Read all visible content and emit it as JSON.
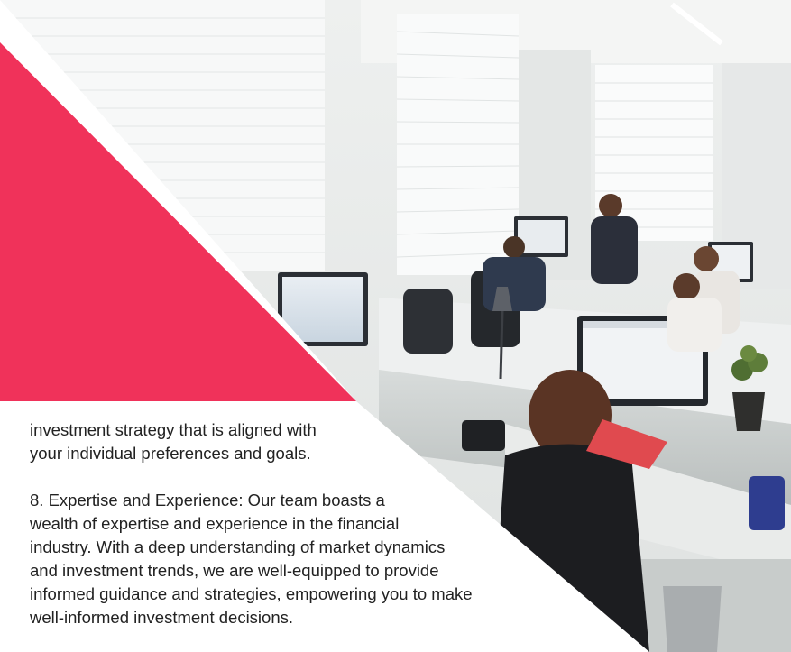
{
  "colors": {
    "accent": "#f0325a",
    "text": "#222222",
    "background": "#ffffff"
  },
  "image": {
    "icon": "office-photo"
  },
  "text": {
    "para1_line1": "investment strategy that is aligned with",
    "para1_line2": "your individual preferences and goals.",
    "para2_line1": "8. Expertise and Experience: Our team boasts a",
    "para2_line2": "wealth of expertise and experience in the financial",
    "para2_line3": "industry. With a deep understanding of market dynamics",
    "para2_line4": "and investment trends, we are well-equipped to provide",
    "para2_line5": "informed guidance and strategies, empowering you to make",
    "para2_line6": "well-informed investment decisions."
  }
}
